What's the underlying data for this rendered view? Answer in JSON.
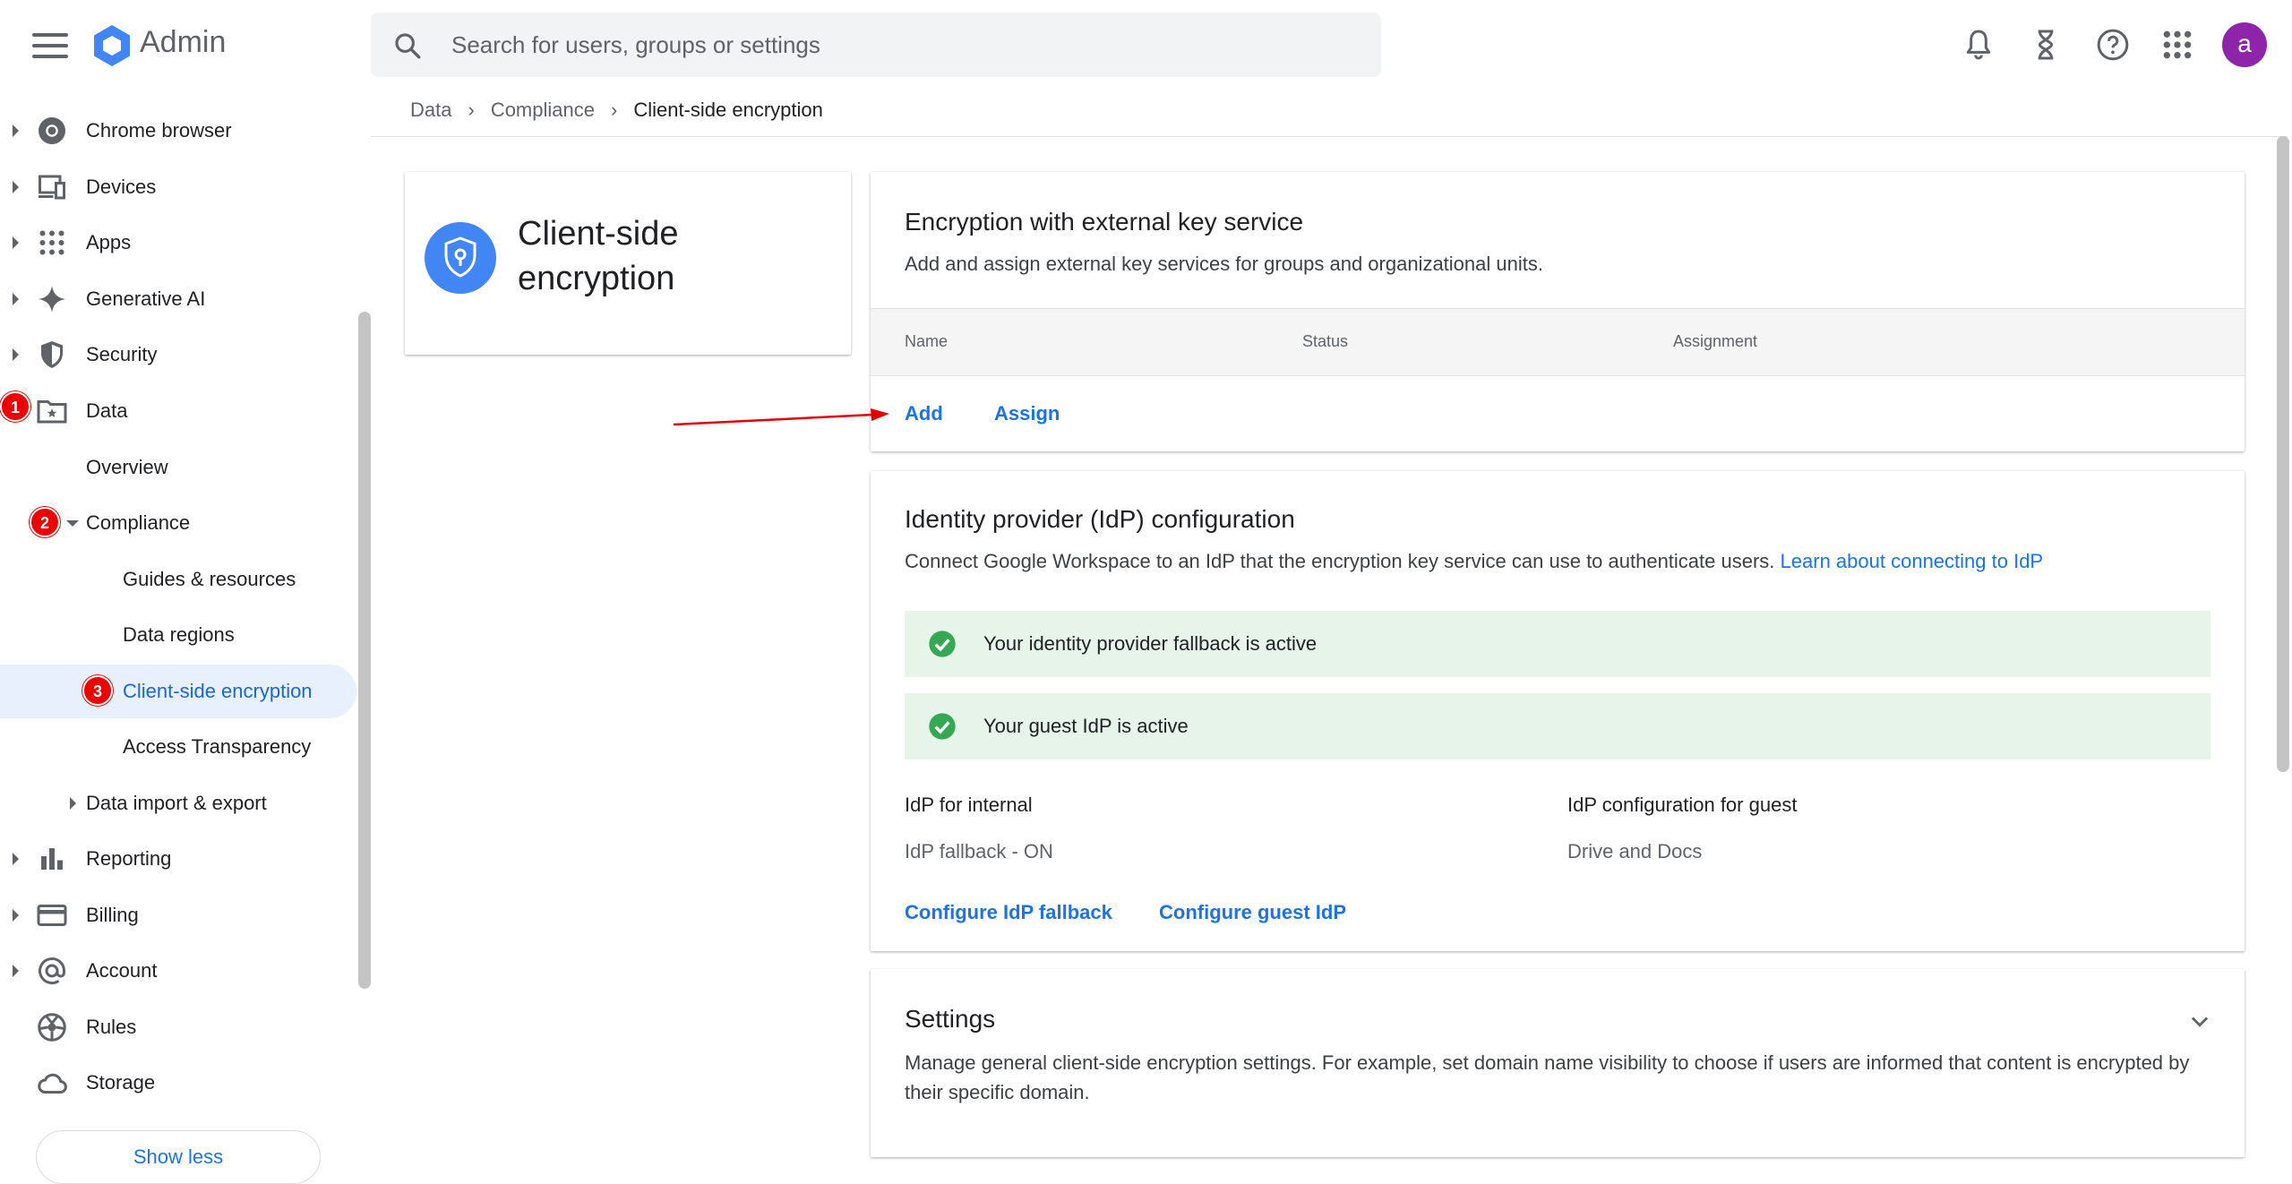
{
  "header": {
    "brand": "Admin",
    "search_placeholder": "Search for users, groups or settings",
    "avatar_letter": "a"
  },
  "sidebar": {
    "items": [
      {
        "label": "Chrome browser"
      },
      {
        "label": "Devices"
      },
      {
        "label": "Apps"
      },
      {
        "label": "Generative AI"
      },
      {
        "label": "Security"
      },
      {
        "label": "Data"
      },
      {
        "label": "Overview"
      },
      {
        "label": "Compliance"
      },
      {
        "label": "Guides & resources"
      },
      {
        "label": "Data regions"
      },
      {
        "label": "Client-side encryption"
      },
      {
        "label": "Access Transparency"
      },
      {
        "label": "Data import & export"
      },
      {
        "label": "Reporting"
      },
      {
        "label": "Billing"
      },
      {
        "label": "Account"
      },
      {
        "label": "Rules"
      },
      {
        "label": "Storage"
      }
    ],
    "show_less": "Show less",
    "badges": [
      "1",
      "2",
      "3"
    ]
  },
  "breadcrumb": {
    "items": [
      "Data",
      "Compliance",
      "Client-side encryption"
    ],
    "separator": "›"
  },
  "title_card": {
    "title": "Client-side encryption"
  },
  "encryption_card": {
    "title": "Encryption with external key service",
    "description": "Add and assign external key services for groups and organizational units.",
    "columns": [
      "Name",
      "Status",
      "Assignment"
    ],
    "add_label": "Add",
    "assign_label": "Assign"
  },
  "idp_card": {
    "title": "Identity provider (IdP) configuration",
    "description": "Connect Google Workspace to an IdP that the encryption key service can use to authenticate users.",
    "learn_link": "Learn about connecting to IdP",
    "banners": [
      "Your identity provider fallback is active",
      "Your guest IdP is active"
    ],
    "internal_heading": "IdP for internal",
    "internal_value": "IdP fallback - ON",
    "guest_heading": "IdP configuration for guest",
    "guest_value": "Drive and Docs",
    "configure_fallback": "Configure IdP fallback",
    "configure_guest": "Configure guest IdP"
  },
  "settings_card": {
    "title": "Settings",
    "description_line1": "Manage general client-side encryption settings. For example, set domain name visibility to choose if users are informed that content is encrypted by",
    "description_line2": "their specific domain."
  },
  "colors": {
    "accent": "#1a73e8",
    "active_bg": "#e8f0fe",
    "success_bg": "#e6f4ea",
    "success_icon": "#34a853",
    "annotation": "#e00000",
    "avatar": "#8e24aa"
  }
}
